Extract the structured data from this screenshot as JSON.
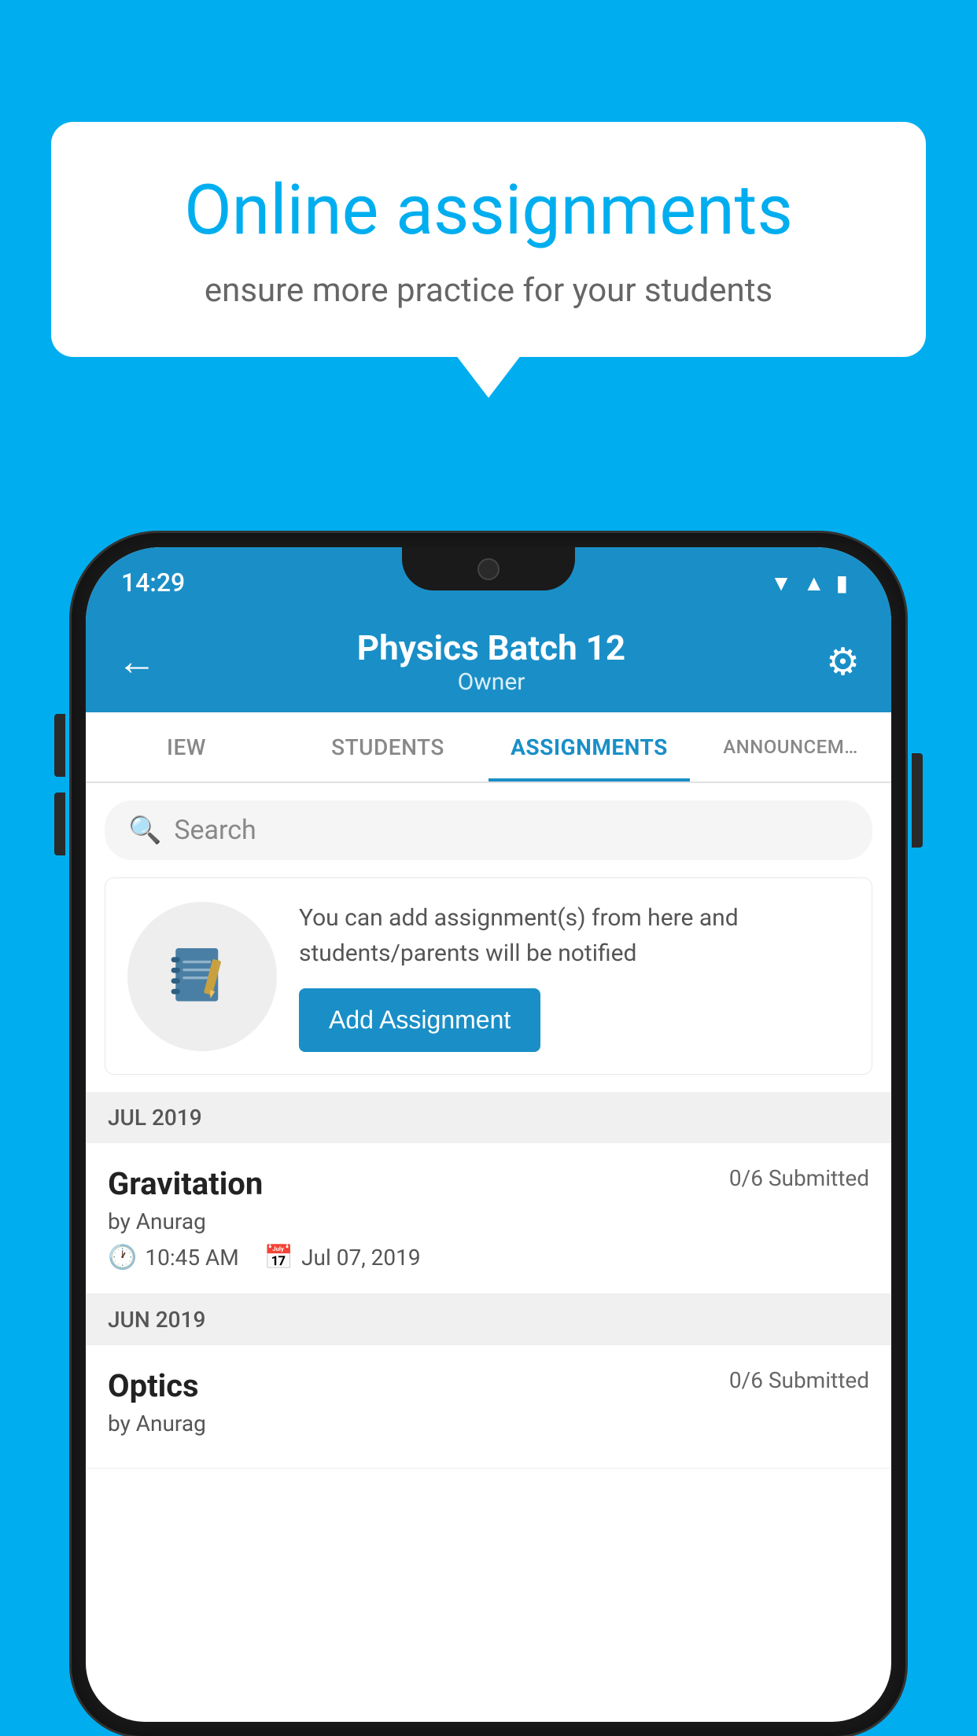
{
  "background": {
    "color": "#00AEEF"
  },
  "speech_bubble": {
    "title": "Online assignments",
    "subtitle": "ensure more practice for your students"
  },
  "phone": {
    "status_bar": {
      "time": "14:29"
    },
    "app_bar": {
      "title": "Physics Batch 12",
      "subtitle": "Owner",
      "back_label": "←",
      "settings_label": "⚙"
    },
    "tabs": [
      {
        "label": "IEW",
        "active": false
      },
      {
        "label": "STUDENTS",
        "active": false
      },
      {
        "label": "ASSIGNMENTS",
        "active": true
      },
      {
        "label": "ANNOUNCEM…",
        "active": false
      }
    ],
    "search": {
      "placeholder": "Search"
    },
    "promo": {
      "description": "You can add assignment(s) from here and students/parents will be notified",
      "button_label": "Add Assignment"
    },
    "sections": [
      {
        "month": "JUL 2019",
        "assignments": [
          {
            "title": "Gravitation",
            "submitted": "0/6 Submitted",
            "by": "by Anurag",
            "time": "10:45 AM",
            "date": "Jul 07, 2019"
          }
        ]
      },
      {
        "month": "JUN 2019",
        "assignments": [
          {
            "title": "Optics",
            "submitted": "0/6 Submitted",
            "by": "by Anurag",
            "time": "",
            "date": ""
          }
        ]
      }
    ]
  }
}
